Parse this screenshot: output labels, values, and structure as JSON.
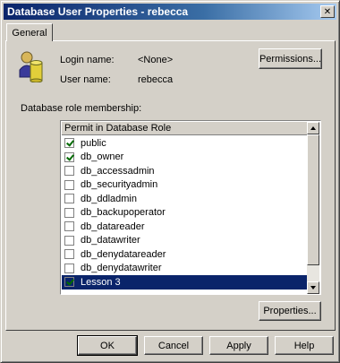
{
  "window": {
    "title": "Database User Properties - rebecca",
    "close_glyph": "✕"
  },
  "tabs": [
    {
      "label": "General"
    }
  ],
  "general": {
    "login_label": "Login name:",
    "login_value": "<None>",
    "user_label": "User name:",
    "user_value": "rebecca",
    "permissions_button": "Permissions...",
    "role_membership_label": "Database role membership:"
  },
  "roles_list": {
    "header": "Permit in Database Role",
    "rows": [
      {
        "name": "public",
        "checked": true
      },
      {
        "name": "db_owner",
        "checked": true
      },
      {
        "name": "db_accessadmin",
        "checked": false
      },
      {
        "name": "db_securityadmin",
        "checked": false
      },
      {
        "name": "db_ddladmin",
        "checked": false
      },
      {
        "name": "db_backupoperator",
        "checked": false
      },
      {
        "name": "db_datareader",
        "checked": false
      },
      {
        "name": "db_datawriter",
        "checked": false
      },
      {
        "name": "db_denydatareader",
        "checked": false
      },
      {
        "name": "db_denydatawriter",
        "checked": false
      },
      {
        "name": "Lesson 3",
        "checked": true,
        "selected": true
      }
    ]
  },
  "properties_button": "Properties...",
  "footer": {
    "ok": "OK",
    "cancel": "Cancel",
    "apply": "Apply",
    "help": "Help"
  },
  "colors": {
    "title_active": "#0a246a",
    "face": "#d4d0c8",
    "selection": "#0a246a",
    "check": "#006a00"
  },
  "icons": {
    "user": "database-user-icon",
    "close": "close-icon"
  }
}
